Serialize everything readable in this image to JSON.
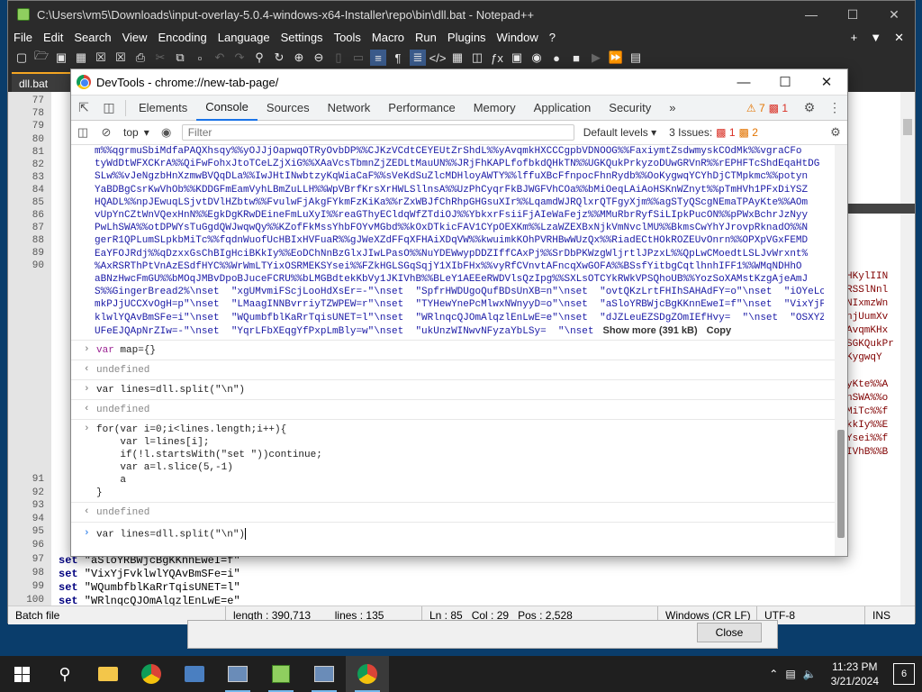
{
  "npp": {
    "title": "C:\\Users\\vm5\\Downloads\\input-overlay-5.0.4-windows-x64-Installer\\repo\\bin\\dll.bat - Notepad++",
    "menu": [
      "File",
      "Edit",
      "Search",
      "View",
      "Encoding",
      "Language",
      "Settings",
      "Tools",
      "Macro",
      "Run",
      "Plugins",
      "Window",
      "?"
    ],
    "menu_right": [
      "+",
      "▼",
      "✕"
    ],
    "tab": "dll.bat",
    "lines_top": [
      "77",
      "78",
      "79",
      "80",
      "81",
      "82",
      "83",
      "84",
      "85",
      "86",
      "87",
      "88",
      "89",
      "90"
    ],
    "lines_bottom": [
      "91",
      "92",
      "93",
      "94",
      "95",
      "96",
      "97",
      "98",
      "99",
      "100"
    ],
    "code_bottom": [
      {
        "kw": "set",
        "str": " \"aSloYRBWjcBgKKnnEweI=f\""
      },
      {
        "kw": "set",
        "str": " \"VixYjFvklwlYQAvBmSFe=i\""
      },
      {
        "kw": "set",
        "str": " \"WQumbfblKaRrTqisUNET=l\""
      },
      {
        "kw": "set",
        "str": " \"WRlnqcQJOmAlqzlEnLwE=e\""
      }
    ],
    "status": {
      "type": "Batch file",
      "length": "length : 390,713",
      "lines": "lines : 135",
      "ln": "Ln : 85",
      "col": "Col : 29",
      "pos": "Pos : 2,528",
      "eol": "Windows (CR LF)",
      "enc": "UTF-8",
      "ins": "INS"
    },
    "side_text": [
      "HKylIIN",
      "RSSlNnl",
      "NIxmzWn",
      "njUumXv",
      "AvqmKHx",
      "SGKQukPr",
      "KygwqY",
      "",
      "yKte%%A",
      "nSWA%%o",
      "MiTc%%f",
      "kkIy%%E",
      "Ysei%%f",
      "IVhB%%B"
    ]
  },
  "dialog": {
    "close_label": "Close"
  },
  "devtools": {
    "title": "DevTools - chrome://new-tab-page/",
    "tabs": [
      "Elements",
      "Console",
      "Sources",
      "Network",
      "Performance",
      "Memory",
      "Application",
      "Security"
    ],
    "more_tabs": "»",
    "warn_count": "7",
    "err_count": "1",
    "context": "top",
    "filter_placeholder": "Filter",
    "levels": "Default levels",
    "issues_label": "3 Issues:",
    "issues_err": "1",
    "issues_warn": "2",
    "dump_lines": [
      "m%%qgrmuSbiMdfaPAQXhsqy%%yOJJjOapwqOTRyOvbDP%%CJKzVCdtCEYEUtZrShdL%%yAvqmkHXCCCgpbVDNOOG%%FaxiymtZsdwmyskCOdMk%%vgraCFo",
      "tyWdDtWFXCKrA%%QiFwFohxJtoTCeLZjXiG%%XAaVcsTbmnZjZEDLtMauUN%%JRjFhKAPLfofbkdQHkTN%%UGKQukPrkyzoDUwGRVnR%%rEPHFTcShdEqaHtDG",
      "SLw%%vJeNgzbHnXzmwBVQqDLa%%IwJHtINwbtzyKqWiaCaF%%sVeKdSuZlcMDHloyAWTY%%lffuXBcFfnpocFhnRydb%%OoKygwqYCYhDjCTMpkmc%%potyn",
      "YaBDBgCsrKwVhOb%%KDDGFmEamVyhLBmZuLLH%%WpVBrfKrsXrHWLSllnsA%%UzPhCyqrFkBJWGFVhCOa%%bMiOeqLAiAoHSKnWZnyt%%pTmHVh1PFxDiYSZ",
      "HQADL%%npJEwuqLSjvtDVlHZbtw%%FvulwFjAkgFYkmFzKiKa%%rZxWBJfChRhpGHGsuXIr%%LqamdWJRQlxrQTFgyXjm%%agSTyQScgNEmaTPAyKte%%AOm",
      "vUpYnCZtWnVQexHnN%%EgkDgKRwDEineFmLuXyI%%reaGThyECldqWfZTdiOJ%%YbkxrFsiiFjAIeWaFejz%%MMuRbrRyfSiLIpkPucON%%pPWxBchrJzNyy",
      "PwLhSWA%%otDPWYsTuGgdQWJwqwQy%%KZofFkMssYhbFOYvMGbd%%kOxDTkicFAV1CYpOEXKm%%LzaWZEXBxNjkVmNvclMU%%BkmsCwYhYJrovpRknadO%%N",
      "gerR1QPLumSLpkbMiTc%%fqdnWuofUcHBIxHVFuaR%%gJWeXZdFFqXFHAiXDqVW%%kwuimkKOhPVRHBwWUzQx%%RiadECtHOkROZEUvOnrn%%OPXpVGxFEMD",
      "EaYFOJRdj%%qDzxxGsChBIgHciBKkIy%%EoDChNnBzGlxJIwLPasO%%NuYDEWwypDDZIffCAxPj%%SrDbPKWzgWljrtlJPzxL%%QpLwCMoedtLSLJvWrxnt%",
      "%AxRSRThPtVnAzESdfHYC%%WrWmLTYixOSRMEKSYsei%%FZkHGLSGqSqjY1XIbFHx%%vyRfCVnvtAFncqXwGOFA%%BSsfYitbgCqtlhnhIFF1%%WMqNDHhO",
      "aBNzHwcFmGU%%bMOqJMBvDpoBJuceFCRU%%bLMGBdtekKbVy1JKIVhB%%BLeY1AEEeRWDVlsQzIpg%%SXLsOTCYkRWkVPSQhoUB%%YozSoXAMstKzgAjeAmJ",
      "S%%GingerBread2%\\nset  \"xgUMvmiFScjLooHdXsEr=-\"\\nset  \"SpfrHWDUgoQufBDsUnXB=n\"\\nset  \"ovtQKzLrtFHIhSAHAdFY=o\"\\nset  \"iOYeLof",
      "mkPJjUCCXvOgH=p\"\\nset  \"LMaagINNBvrriyTZWPEW=r\"\\nset  \"TYHewYnePcMlwxNWnyyD=o\"\\nset  \"aSloYRBWjcBgKKnnEweI=f\"\\nset  \"VixYjFv",
      "klwlYQAvBmSFe=i\"\\nset  \"WQumbfblKaRrTqisUNET=l\"\\nset  \"WRlnqcQJOmAlqzlEnLwE=e\"\\nset  \"dJZLeuEZSDgZOmIEfHvy=  \"\\nset  \"OSXYZGA",
      "UFeEJQApNrZIw=-\"\\nset  \"YqrLFbXEqgYfPxpLmBly=w\"\\nset  \"ukUnzWINwvNFyzaYbLSy=  \"\\nset"
    ],
    "show_more": "Show more (391 kB)",
    "copy": "Copy",
    "entries": [
      {
        "type": "in",
        "code": "var map={}"
      },
      {
        "type": "out",
        "code": "undefined"
      },
      {
        "type": "in",
        "code": "var lines=dll.split(\"\\n\")"
      },
      {
        "type": "out",
        "code": "undefined"
      },
      {
        "type": "in",
        "code": "for(var i=0;i<lines.length;i++){\n    var l=lines[i];\n    if(!l.startsWith(\"set \"))continue;\n    var a=l.slice(5,-1)\n    a\n}"
      },
      {
        "type": "out",
        "code": "undefined"
      },
      {
        "type": "prompt",
        "code": "var lines=dll.split(\"\\n\")"
      }
    ]
  },
  "taskbar": {
    "time": "11:23 PM",
    "date": "3/21/2024",
    "notifications": "6"
  }
}
